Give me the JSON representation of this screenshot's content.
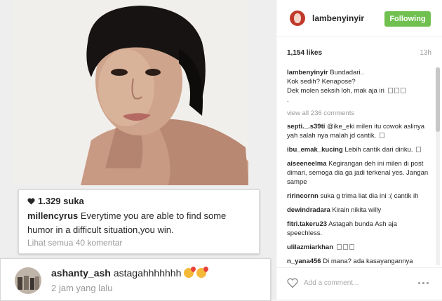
{
  "left_feed": {
    "card1": {
      "likes": "1.329 suka",
      "username": "millencyrus",
      "caption": "Everytime you are able to find some humor in a difficult situation,you win.",
      "view_comments": "Lihat semua 40 komentar"
    },
    "card2": {
      "username": "ashanty_ash",
      "comment": "astagahhhhhhh",
      "time": "2 jam yang lalu"
    }
  },
  "post_panel": {
    "username": "lambenyinyir",
    "follow_label": "Following",
    "likes": "1,154 likes",
    "time": "13h",
    "caption_user": "lambenyinyir",
    "caption_line1": "Bundadari..",
    "caption_line2": "Kok sedih? Kenapose?",
    "caption_line3": "Dek molen seksih loh, mak aja iri",
    "caption_line4": ".",
    "view_all": "view all 236 comments",
    "comments": [
      {
        "user": "septi._.s39ti",
        "text": "@ike_eki milen itu cowok aslinya yah salah nya malah jd cantik."
      },
      {
        "user": "ibu_emak_kucing",
        "text": "Lebih cantik dari diriku."
      },
      {
        "user": "aiseeneelma",
        "text": "Kegirangan deh ini milen di post dimari, semoga dia ga jadi terkenal yes. Jangan sampe"
      },
      {
        "user": "ririncornn",
        "text": "suka g trima liat dia ini :( cantik ih"
      },
      {
        "user": "dewindradara",
        "text": "Kirain nikita willy"
      },
      {
        "user": "fitri.takeru23",
        "text": "Astagah bunda Ash aja speechless."
      },
      {
        "user": "ulilazmiarkhan",
        "text": ""
      },
      {
        "user": "n_yana456",
        "text": "Di mana? ada kasayangannya"
      }
    ],
    "add_comment_placeholder": "Add a comment..."
  },
  "icons": {
    "heart_filled": "heart-icon",
    "heart_outline": "heart-outline-icon",
    "more": "more-options-icon"
  },
  "colors": {
    "follow_green": "#70c050",
    "text_dark": "#262626",
    "text_muted": "#999999"
  }
}
